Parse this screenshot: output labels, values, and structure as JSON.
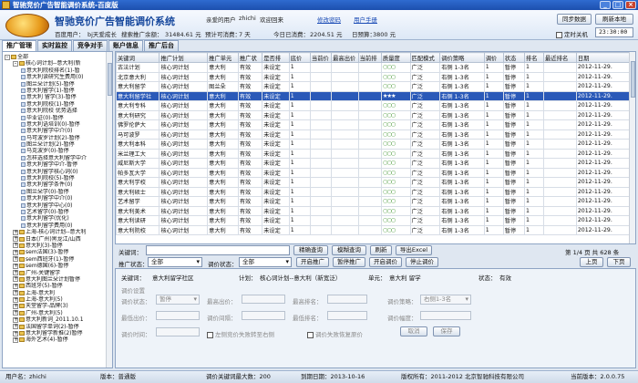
{
  "window": {
    "title": "智驰竞价广告智能调价系统-百度版"
  },
  "header": {
    "app_title": "智驰竞价广告智能调价系统",
    "user_label": "亲爱的用户",
    "user_name": "zhichi",
    "welcome": "欢迎回来",
    "link_change_password": "修改密码",
    "link_manual": "用户手册",
    "btn_sync": "同步数据",
    "btn_refresh": "刷新本地",
    "account_label": "百度用户：",
    "account_name": "bj天爱成长",
    "balance_label": "搜索推广余额：",
    "balance_value": "31484.61 元",
    "days_label": "预计可消费：",
    "days_value": "7 天",
    "today_label": "今日已消费：",
    "today_value": "2204.51 元",
    "budget_label": "日预算：",
    "budget_value": "3800 元",
    "timer_label": "定时关机",
    "timer_value": "23:30:00"
  },
  "tabs": [
    {
      "label": "推广管理",
      "active": true
    },
    {
      "label": "实时监控",
      "active": false
    },
    {
      "label": "竞争对手",
      "active": false
    },
    {
      "label": "账户信息",
      "active": false
    },
    {
      "label": "推广后台",
      "active": false
    }
  ],
  "tree": [
    {
      "t": "-",
      "label": "全部",
      "lvl": 0,
      "folder": true
    },
    {
      "t": "-",
      "label": "核心词计划--意大利(新",
      "lvl": 1,
      "folder": true
    },
    {
      "t": "",
      "label": "意大利院校排名(1)-暂",
      "lvl": 2
    },
    {
      "t": "",
      "label": "意大利读研究生费用(0)",
      "lvl": 2
    },
    {
      "t": "",
      "label": "图兰朵计划(5)-暂停",
      "lvl": 2
    },
    {
      "t": "",
      "label": "意大利留学(1)-暂停",
      "lvl": 2
    },
    {
      "t": "",
      "label": "意大利 留学(3)-暂停",
      "lvl": 2
    },
    {
      "t": "",
      "label": "意大利院校(1)-暂停",
      "lvl": 2
    },
    {
      "t": "",
      "label": "意大利院校 优势选择",
      "lvl": 2
    },
    {
      "t": "",
      "label": "毕业证(0)-暂停",
      "lvl": 2
    },
    {
      "t": "",
      "label": "意大利语培训(0)-暂停",
      "lvl": 2
    },
    {
      "t": "",
      "label": "意大利留学中介(0)",
      "lvl": 2
    },
    {
      "t": "",
      "label": "马可波罗计划(2)-暂停",
      "lvl": 2
    },
    {
      "t": "",
      "label": "图兰朵计划(2)-暂停",
      "lvl": 2
    },
    {
      "t": "",
      "label": "马克波罗(0)-暂停",
      "lvl": 2
    },
    {
      "t": "",
      "label": "怎样选择意大利留学中介",
      "lvl": 2
    },
    {
      "t": "",
      "label": "意大利留学中介-暂停",
      "lvl": 2
    },
    {
      "t": "",
      "label": "意大利留学核心词(0)",
      "lvl": 2
    },
    {
      "t": "",
      "label": "意大利院校(5)-暂停",
      "lvl": 2
    },
    {
      "t": "",
      "label": "意大利留学条件(0)",
      "lvl": 2
    },
    {
      "t": "",
      "label": "图兰朵学(0)-暂停",
      "lvl": 2
    },
    {
      "t": "",
      "label": "意大利留学中介(0)",
      "lvl": 2
    },
    {
      "t": "",
      "label": "意大利留学中心(0)",
      "lvl": 2
    },
    {
      "t": "",
      "label": "艺术留学(0)-暂停",
      "lvl": 2
    },
    {
      "t": "",
      "label": "意大利留学(优化)",
      "lvl": 2
    },
    {
      "t": "",
      "label": "意大利留学费用(0)",
      "lvl": 2
    },
    {
      "t": "+",
      "label": "上海-核心词计划--意大利",
      "lvl": 1,
      "folder": true
    },
    {
      "t": "+",
      "label": "日本(广州)黑龙江/山西",
      "lvl": 1,
      "folder": true
    },
    {
      "t": "+",
      "label": "意大利(3)-暂停",
      "lvl": 1,
      "folder": true
    },
    {
      "t": "+",
      "label": "sem法国(3)-暂停",
      "lvl": 1,
      "folder": true
    },
    {
      "t": "+",
      "label": "sem西班牙(1)-暂停",
      "lvl": 1,
      "folder": true
    },
    {
      "t": "+",
      "label": "sem德国(6)-暂停",
      "lvl": 1,
      "folder": true
    },
    {
      "t": "+",
      "label": "广州-关键留学",
      "lvl": 1,
      "folder": true
    },
    {
      "t": "+",
      "label": "意大利图兰朵计划暂停",
      "lvl": 1,
      "folder": true
    },
    {
      "t": "+",
      "label": "西班牙(5)-暂停",
      "lvl": 1,
      "folder": true
    },
    {
      "t": "+",
      "label": "上海-意大利",
      "lvl": 1,
      "folder": true
    },
    {
      "t": "+",
      "label": "上海-意大利(5)",
      "lvl": 1,
      "folder": true
    },
    {
      "t": "+",
      "label": "天堂留学-品牌(3)",
      "lvl": 1,
      "folder": true
    },
    {
      "t": "+",
      "label": "广州-意大利(5)",
      "lvl": 1,
      "folder": true
    },
    {
      "t": "+",
      "label": "意大利新词_2011.10.1",
      "lvl": 1,
      "folder": true
    },
    {
      "t": "+",
      "label": "法国留学单词(2)-暂停",
      "lvl": 1,
      "folder": true
    },
    {
      "t": "+",
      "label": "意大利留学新推(2)暂停",
      "lvl": 1,
      "folder": true
    },
    {
      "t": "+",
      "label": "海外艺术(4)-暂停",
      "lvl": 1,
      "folder": true
    }
  ],
  "grid": {
    "columns": [
      "关键词",
      "推广计划",
      "推广单元",
      "推广状",
      "是否排",
      "底价",
      "当前价",
      "最高出价",
      "当前排",
      "质量度",
      "匹配模式",
      "调价策略",
      "调价",
      "状态",
      "排名",
      "最近排名",
      "日期"
    ],
    "rows": [
      [
        "古法计划",
        "核心词计划",
        "意大利",
        "有效",
        "未设定",
        "1",
        "",
        "",
        "",
        "○○○",
        "广泛",
        "右侧 1-3名",
        "1",
        "暂停",
        "1",
        "",
        "2012-11-29."
      ],
      [
        "北京意大利",
        "核心词计划",
        "意大利",
        "有效",
        "未设定",
        "1",
        "",
        "",
        "",
        "○○○",
        "广泛",
        "右侧 1-3名",
        "1",
        "暂停",
        "1",
        "",
        "2012-11-29."
      ],
      [
        "意大利留学",
        "核心词计划",
        "图兰朵",
        "有效",
        "未设定",
        "1",
        "",
        "",
        "",
        "○○○",
        "广泛",
        "右侧 1-3名",
        "1",
        "暂停",
        "1",
        "",
        "2012-11-29."
      ],
      [
        "意大利留学社",
        "核心词计划",
        "意大利",
        "有效",
        "未设定",
        "1",
        "",
        "",
        "",
        "★★★",
        "广泛",
        "右侧 1-3名",
        "1",
        "暂停",
        "1",
        "",
        "2012-11-29."
      ],
      [
        "意大利专科",
        "核心词计划",
        "意大利",
        "有效",
        "未设定",
        "1",
        "",
        "",
        "",
        "○○○",
        "广泛",
        "右侧 1-3名",
        "1",
        "暂停",
        "1",
        "",
        "2012-11-29."
      ],
      [
        "意大利研究",
        "核心词计划",
        "意大利",
        "有效",
        "未设定",
        "1",
        "",
        "",
        "",
        "○○○",
        "广泛",
        "右侧 1-3名",
        "1",
        "暂停",
        "1",
        "",
        "2012-11-29."
      ],
      [
        "佛罗伦萨大",
        "核心词计划",
        "意大利",
        "有效",
        "未设定",
        "1",
        "",
        "",
        "",
        "○○○",
        "广泛",
        "右侧 1-3名",
        "1",
        "暂停",
        "1",
        "",
        "2012-11-29."
      ],
      [
        "马可波罗",
        "核心词计划",
        "意大利",
        "有效",
        "未设定",
        "1",
        "",
        "",
        "",
        "○○○",
        "广泛",
        "右侧 1-3名",
        "1",
        "暂停",
        "1",
        "",
        "2012-11-29."
      ],
      [
        "意大利本科",
        "核心词计划",
        "意大利",
        "有效",
        "未设定",
        "1",
        "",
        "",
        "",
        "○○○",
        "广泛",
        "右侧 1-3名",
        "1",
        "暂停",
        "1",
        "",
        "2012-11-29."
      ],
      [
        "米兰理工大",
        "核心词计划",
        "意大利",
        "有效",
        "未设定",
        "1",
        "",
        "",
        "",
        "○○○",
        "广泛",
        "右侧 1-3名",
        "1",
        "暂停",
        "1",
        "",
        "2012-11-29."
      ],
      [
        "威尼斯大学",
        "核心词计划",
        "意大利",
        "有效",
        "未设定",
        "1",
        "",
        "",
        "",
        "○○○",
        "广泛",
        "右侧 1-3名",
        "1",
        "暂停",
        "1",
        "",
        "2012-11-29."
      ],
      [
        "帕多瓦大学",
        "核心词计划",
        "意大利",
        "有效",
        "未设定",
        "1",
        "",
        "",
        "",
        "○○○",
        "广泛",
        "右侧 1-3名",
        "1",
        "暂停",
        "1",
        "",
        "2012-11-29."
      ],
      [
        "意大利学校",
        "核心词计划",
        "意大利",
        "有效",
        "未设定",
        "1",
        "",
        "",
        "",
        "○○○",
        "广泛",
        "右侧 1-3名",
        "1",
        "暂停",
        "1",
        "",
        "2012-11-29."
      ],
      [
        "意大利硕士",
        "核心词计划",
        "意大利",
        "有效",
        "未设定",
        "1",
        "",
        "",
        "",
        "○○○",
        "广泛",
        "右侧 1-3名",
        "1",
        "暂停",
        "1",
        "",
        "2012-11-29."
      ],
      [
        "艺术留学",
        "核心词计划",
        "意大利",
        "有效",
        "未设定",
        "1",
        "",
        "",
        "",
        "○○○",
        "广泛",
        "右侧 1-3名",
        "1",
        "暂停",
        "1",
        "",
        "2012-11-29."
      ],
      [
        "意大利美术",
        "核心词计划",
        "意大利",
        "有效",
        "未设定",
        "1",
        "",
        "",
        "",
        "○○○",
        "广泛",
        "右侧 1-3名",
        "1",
        "暂停",
        "1",
        "",
        "2012-11-29."
      ],
      [
        "意大利读研",
        "核心词计划",
        "意大利",
        "有效",
        "未设定",
        "1",
        "",
        "",
        "",
        "○○○",
        "广泛",
        "右侧 1-3名",
        "1",
        "暂停",
        "1",
        "",
        "2012-11-29."
      ],
      [
        "意大利院校",
        "核心词计划",
        "意大利",
        "有效",
        "未设定",
        "1",
        "",
        "",
        "",
        "○○○",
        "广泛",
        "右侧 1-3名",
        "1",
        "暂停",
        "1",
        "",
        "2012-11-29."
      ]
    ],
    "selected_row": 3
  },
  "filters": {
    "keyword_label": "关键词：",
    "keyword_value": "",
    "btn_exact": "精确查询",
    "btn_fuzzy": "模糊查询",
    "btn_refresh": "刷新",
    "btn_export": "导出Excel",
    "status_label": "推广状态：",
    "status_value": "全部",
    "price_status_label": "调价状态：",
    "price_status_value": "全部",
    "btn_start_monitor": "开启推广",
    "btn_pause_monitor": "暂停推广",
    "btn_start_price": "开启调价",
    "btn_stop_price": "停止调价",
    "page_info": "第 1/4 页   共 628 条",
    "btn_prev": "上页",
    "btn_next": "下页"
  },
  "info": {
    "kw_label": "关键词：",
    "kw_value": "意大利留学社区",
    "plan_label": "计划：",
    "plan_value": "核心词计划--意大利（新宽泛）",
    "unit_label": "单元：",
    "unit_value": "意大利 留学",
    "status_label": "状态：",
    "status_value": "有效",
    "section_title": "调价设置",
    "f1": "调价状态：",
    "f1v": "暂停",
    "f2": "最高出价：",
    "f2v": "",
    "f3": "最高排名：",
    "f3v": "",
    "f4": "调价策略：",
    "f4v": "右侧1-3名",
    "f5": "最低出价：",
    "f5v": "",
    "f6": "调价间隔：",
    "f6v": "",
    "f7": "最低排名：",
    "f7v": "",
    "f8": "调价幅度：",
    "f8v": "",
    "f9": "调价时间：",
    "f9v": "",
    "chk1": "左侧竞价失败转至右侧",
    "chk2": "调价失败恢复原价",
    "btn_cancel": "取消",
    "btn_save": "保存"
  },
  "status": {
    "user": "用户名：zhichi",
    "version": "版本：普通版",
    "keywords": "调价关键词最大数：200",
    "expire": "到期日期：2013-10-16",
    "copyright": "版权所有：2011-2012 北京智驰科技有限公司",
    "current_version": "当前版本：2.0.0.75"
  }
}
